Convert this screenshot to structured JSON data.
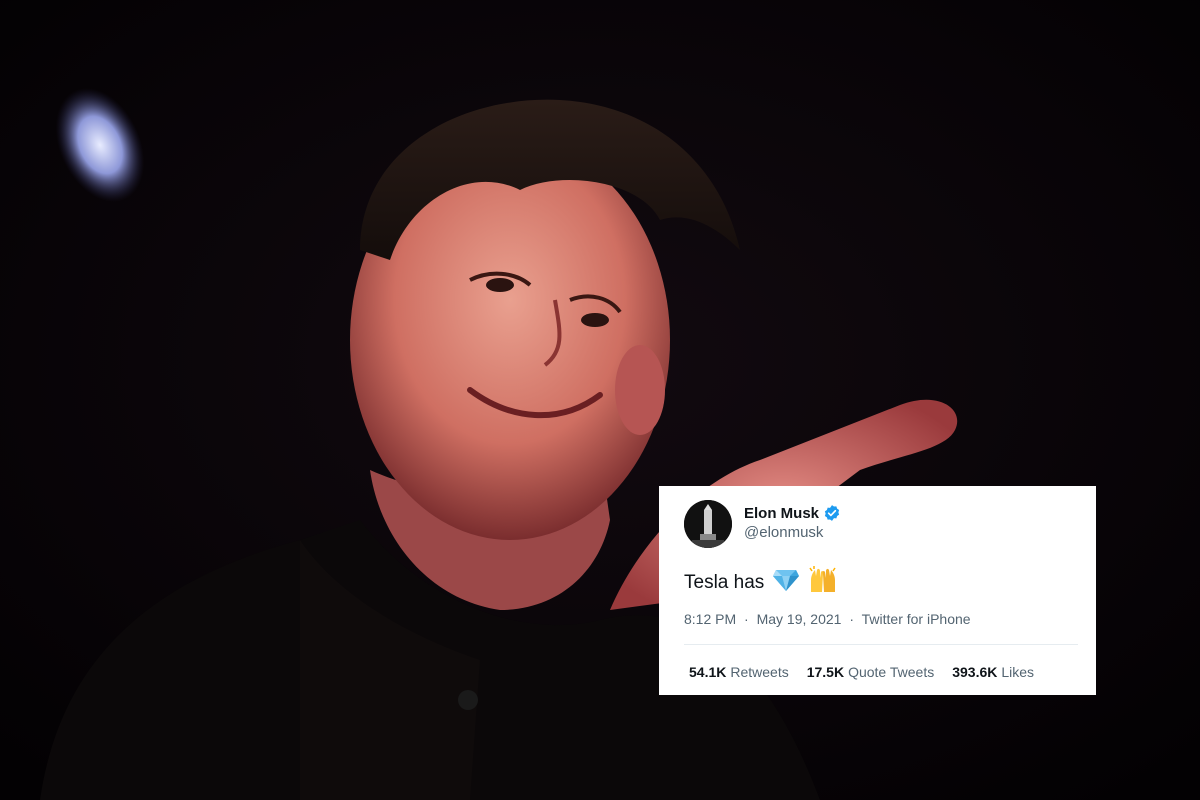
{
  "colors": {
    "background": "#050204",
    "card_background": "#ffffff",
    "verified": "#1d9bf0",
    "text_primary": "#0f1419",
    "text_secondary": "#536471"
  },
  "photo": {
    "icon": "person-photo"
  },
  "tweet": {
    "display_name": "Elon Musk",
    "handle": "@elonmusk",
    "verified": true,
    "text": "Tesla has",
    "emojis": [
      "gem-icon",
      "raising-hands-icon"
    ],
    "meta": {
      "time": "8:12 PM",
      "separator": "·",
      "date": "May 19, 2021",
      "source": "Twitter for iPhone"
    },
    "stats": {
      "retweets_count": "54.1K",
      "retweets_label": "Retweets",
      "quote_count": "17.5K",
      "quote_label": "Quote Tweets",
      "likes_count": "393.6K",
      "likes_label": "Likes"
    }
  }
}
